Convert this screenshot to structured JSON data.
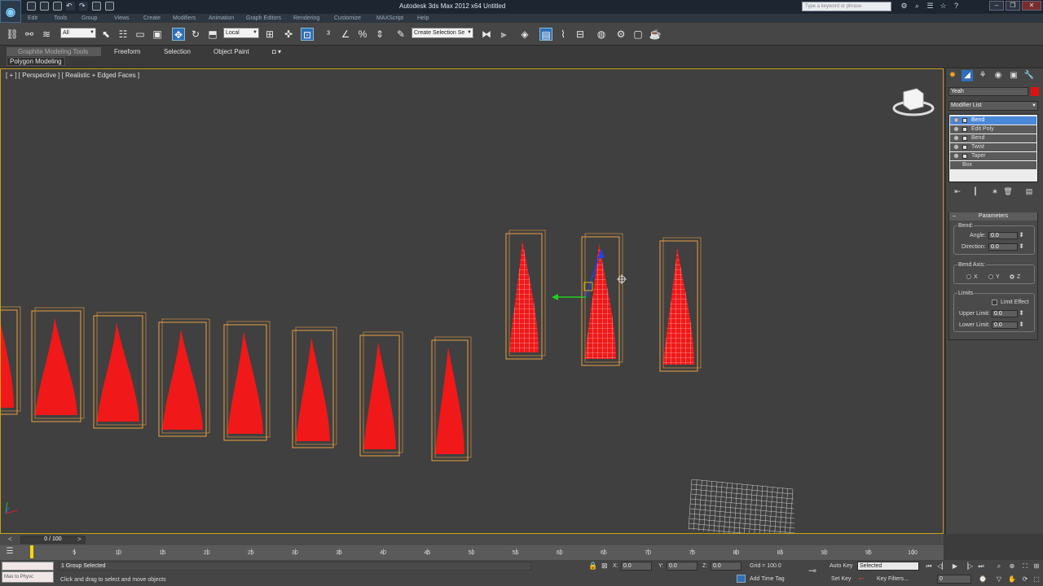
{
  "titlebar": {
    "app_title": "Autodesk 3ds Max 2012 x64      Untitled",
    "search_placeholder": "Type a keyword or phrase",
    "window_controls": [
      "–",
      "❐",
      "✕"
    ]
  },
  "menubar": {
    "items": [
      "Edit",
      "Tools",
      "Group",
      "Views",
      "Create",
      "Modifiers",
      "Animation",
      "Graph Editors",
      "Rendering",
      "Customize",
      "MAXScript",
      "Help"
    ]
  },
  "toolbar": {
    "selection_filter": "All",
    "ref_coord": "Local",
    "named_selection": "Create Selection Se"
  },
  "ribbon": {
    "tabs": [
      "Graphite Modeling Tools",
      "Freeform",
      "Selection",
      "Object Paint"
    ],
    "panel_label": "Polygon Modeling"
  },
  "viewport": {
    "label": "[ + ] [ Perspective ] [ Realistic + Edged Faces ]"
  },
  "command_panel": {
    "object_name": "Yeah",
    "object_color": "#e01010",
    "modifier_list_label": "Modifier List",
    "stack": [
      {
        "label": "Bend",
        "selected": true
      },
      {
        "label": "Edit Poly",
        "selected": false
      },
      {
        "label": "Bend",
        "selected": false
      },
      {
        "label": "Twist",
        "selected": false
      },
      {
        "label": "Taper",
        "selected": false
      },
      {
        "label": "Box",
        "selected": false
      }
    ],
    "parameters": {
      "title": "Parameters",
      "bend_group": "Bend:",
      "angle_label": "Angle:",
      "angle_value": "0.0",
      "direction_label": "Direction:",
      "direction_value": "0.0",
      "axis_group": "Bend Axis:",
      "axis_x": "X",
      "axis_y": "Y",
      "axis_z": "Z",
      "axis_selected": "Z",
      "limits_group": "Limits",
      "limit_effect_label": "Limit Effect",
      "upper_limit_label": "Upper Limit:",
      "upper_limit_value": "0.0",
      "lower_limit_label": "Lower Limit:",
      "lower_limit_value": "0.0"
    }
  },
  "timeline": {
    "slider_label": "0 / 100",
    "ticks": [
      "5",
      "10",
      "15",
      "20",
      "25",
      "30",
      "35",
      "40",
      "45",
      "50",
      "55",
      "60",
      "65",
      "70",
      "75",
      "80",
      "85",
      "90",
      "95",
      "100"
    ]
  },
  "status": {
    "listener_text": "Max to Physc",
    "selection_count": "1 Group Selected",
    "prompt": "Click and drag to select and move objects",
    "x_label": "X:",
    "x_value": "0.0",
    "y_label": "Y:",
    "y_value": "0.0",
    "z_label": "Z:",
    "z_value": "0.0",
    "grid_label": "Grid = 100.0",
    "add_time_tag": "Add Time Tag",
    "auto_key": "Auto Key",
    "auto_key_mode": "Selected",
    "set_key": "Set Key",
    "key_filters": "Key Filters...",
    "frame_value": "0"
  }
}
